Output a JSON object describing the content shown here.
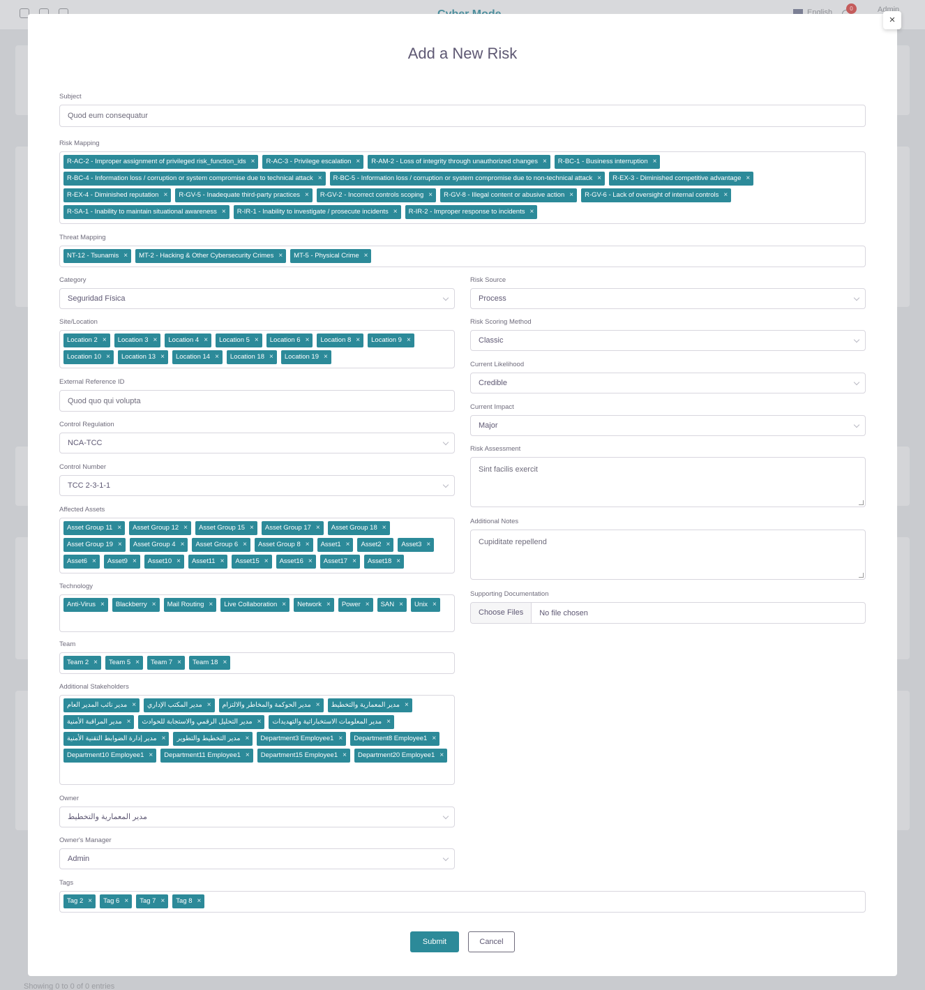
{
  "background": {
    "app_title": "Cyber Mode",
    "language": "English",
    "notification_count": "0",
    "user": "Admin",
    "footer": "Showing 0 to 0 of 0 entries"
  },
  "modal": {
    "title": "Add a New Risk",
    "close_icon": "×",
    "subject": {
      "label": "Subject",
      "value": "Quod eum consequatur"
    },
    "risk_mapping": {
      "label": "Risk Mapping",
      "tags": [
        "R-AC-2 - Improper assignment of privileged risk_function_ids",
        "R-AC-3 - Privilege escalation",
        "R-AM-2 - Loss of integrity through unauthorized changes",
        "R-BC-1 - Business interruption",
        "R-BC-4 - Information loss / corruption or system compromise due to technical attack",
        "R-BC-5 - Information loss / corruption or system compromise due to non-technical attack",
        "R-EX-3 - Diminished competitive advantage",
        "R-EX-4 - Diminished reputation",
        "R-GV-5 - Inadequate third-party practices",
        "R-GV-2 - Incorrect controls scoping",
        "R-GV-8 - Illegal content or abusive action",
        "R-GV-6 - Lack of oversight of internal controls",
        "R-SA-1 - Inability to maintain situational awareness",
        "R-IR-1 - Inability to investigate / prosecute incidents",
        "R-IR-2 - Improper response to incidents"
      ]
    },
    "threat_mapping": {
      "label": "Threat Mapping",
      "tags": [
        "NT-12 - Tsunamis",
        "MT-2 - Hacking & Other Cybersecurity Crimes",
        "MT-5 - Physical Crime"
      ]
    },
    "category": {
      "label": "Category",
      "value": "Seguridad Física"
    },
    "site_location": {
      "label": "Site/Location",
      "tags": [
        "Location 2",
        "Location 3",
        "Location 4",
        "Location 5",
        "Location 6",
        "Location 8",
        "Location 9",
        "Location 10",
        "Location 13",
        "Location 14",
        "Location 18",
        "Location 19"
      ]
    },
    "external_reference": {
      "label": "External Reference ID",
      "value": "Quod quo qui volupta"
    },
    "control_regulation": {
      "label": "Control Regulation",
      "value": "NCA-TCC"
    },
    "control_number": {
      "label": "Control Number",
      "value": "TCC 2-3-1-1"
    },
    "affected_assets": {
      "label": "Affected Assets",
      "tags": [
        "Asset Group 11",
        "Asset Group 12",
        "Asset Group 15",
        "Asset Group 17",
        "Asset Group 18",
        "Asset Group 19",
        "Asset Group 4",
        "Asset Group 6",
        "Asset Group 8",
        "Asset1",
        "Asset2",
        "Asset3",
        "Asset6",
        "Asset9",
        "Asset10",
        "Asset11",
        "Asset15",
        "Asset16",
        "Asset17",
        "Asset18"
      ]
    },
    "technology": {
      "label": "Technology",
      "tags": [
        "Anti-Virus",
        "Blackberry",
        "Mail Routing",
        "Live Collaboration",
        "Network",
        "Power",
        "SAN",
        "Unix"
      ]
    },
    "team": {
      "label": "Team",
      "tags": [
        "Team 2",
        "Team 5",
        "Team 7",
        "Team 18"
      ]
    },
    "stakeholders": {
      "label": "Additional Stakeholders",
      "tags": [
        "مدير نائب المدير العام",
        "مدير المكتب الإداري",
        "مدير الحوكمة والمخاطر والالتزام",
        "مدير المعمارية والتخطيط",
        "مدير المراقبة الأمنية",
        "مدير التحليل الرقمي والاستجابة للحوادث",
        "مدير المعلومات الاستخباراتية والتهديدات",
        "مدير إدارة الضوابط التقنية الأمنية",
        "مدير التخطيط والتطوير",
        "Department3 Employee1",
        "Department8 Employee1",
        "Department10 Employee1",
        "Department11 Employee1",
        "Department15 Employee1",
        "Department20 Employee1"
      ]
    },
    "owner": {
      "label": "Owner",
      "value": "مدير المعمارية والتخطيط"
    },
    "owner_manager": {
      "label": "Owner's Manager",
      "value": "Admin"
    },
    "tags": {
      "label": "Tags",
      "tags": [
        "Tag 2",
        "Tag 6",
        "Tag 7",
        "Tag 8"
      ]
    },
    "risk_source": {
      "label": "Risk Source",
      "value": "Process"
    },
    "risk_scoring_method": {
      "label": "Risk Scoring Method",
      "value": "Classic"
    },
    "current_likelihood": {
      "label": "Current Likelihood",
      "value": "Credible"
    },
    "current_impact": {
      "label": "Current Impact",
      "value": "Major"
    },
    "risk_assessment": {
      "label": "Risk Assessment",
      "value": "Sint facilis exercit"
    },
    "additional_notes": {
      "label": "Additional Notes",
      "value": "Cupiditate repellend"
    },
    "supporting_docs": {
      "label": "Supporting Documentation",
      "button": "Choose Files",
      "status": "No file chosen"
    },
    "submit": "Submit",
    "cancel": "Cancel",
    "chip_remove_symbol": "×"
  },
  "colors": {
    "accent": "#2c8a99",
    "overlay": "#c9cbcf"
  }
}
